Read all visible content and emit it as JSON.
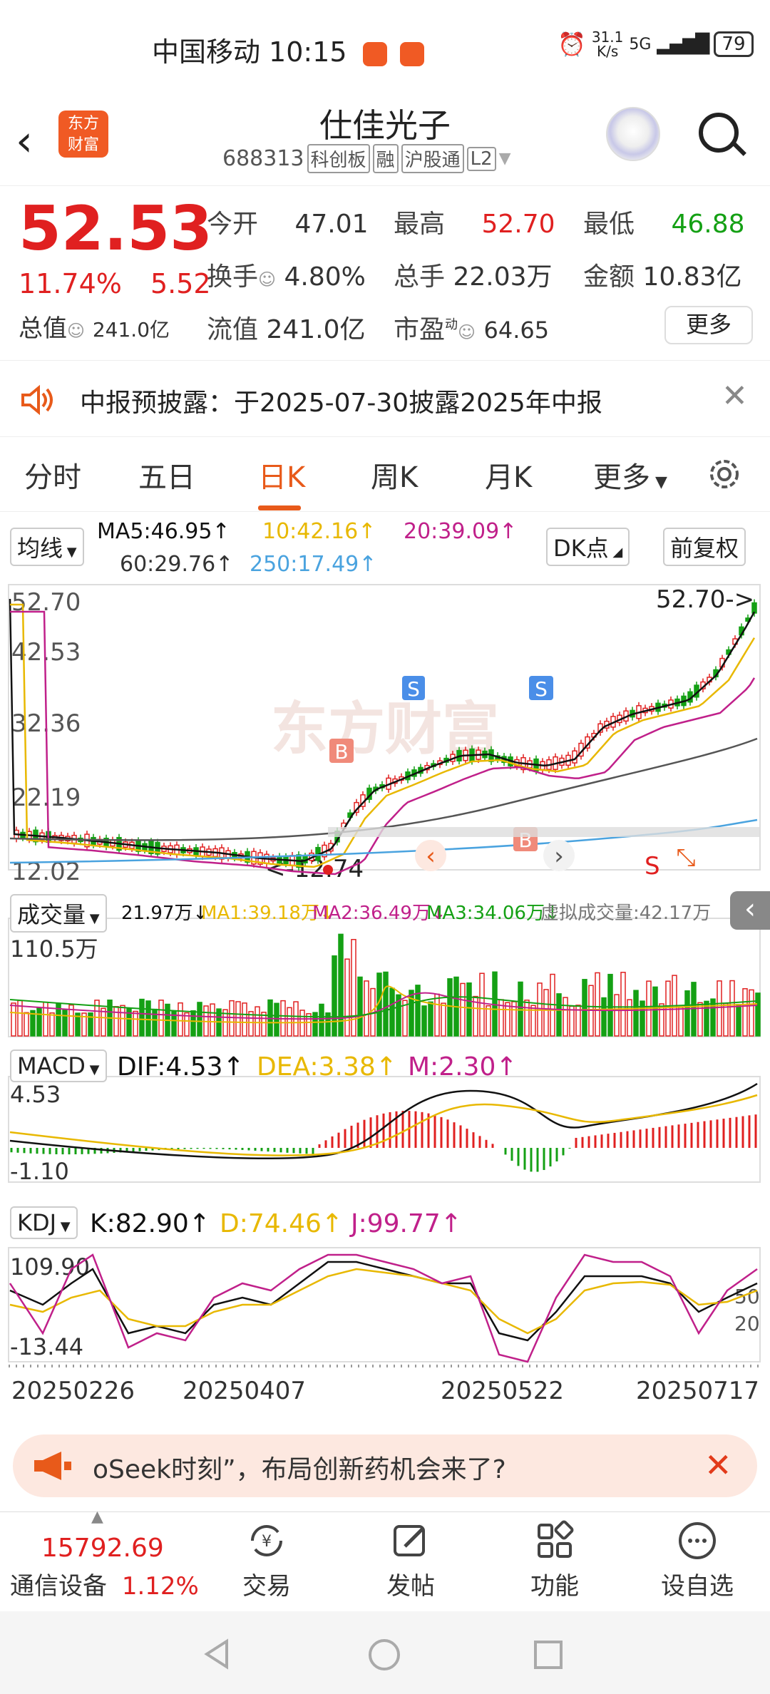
{
  "status_bar": {
    "carrier": "中国移动",
    "time": "10:15",
    "net_speed": "31.1\nK/s",
    "network": "5G",
    "battery": "79"
  },
  "header": {
    "logo_text": "东方\n财富",
    "stock_name": "仕佳光子",
    "stock_code": "688313",
    "tags": [
      "科创板",
      "融",
      "沪股通",
      "L2"
    ]
  },
  "quote": {
    "price": "52.53",
    "change_pct": "11.74%",
    "change_amt": "5.52",
    "mcap_label": "总值",
    "mcap_value": "241.0亿",
    "open_label": "今开",
    "open_value": "47.01",
    "high_label": "最高",
    "high_value": "52.70",
    "low_label": "最低",
    "low_value": "46.88",
    "turnover_label": "换手",
    "turnover_value": "4.80%",
    "volume_label": "总手",
    "volume_value": "22.03万",
    "amount_label": "金额",
    "amount_value": "10.83亿",
    "float_label": "流值",
    "float_value": "241.0亿",
    "pe_label": "市盈",
    "pe_sup": "动",
    "pe_value": "64.65",
    "more_label": "更多"
  },
  "notice": {
    "text": "中报预披露：于2025-07-30披露2025年中报"
  },
  "tabs": [
    "分时",
    "五日",
    "日K",
    "周K",
    "月K",
    "更多"
  ],
  "active_tab": "日K",
  "chart": {
    "ma_select": "均线",
    "ma5": "MA5:46.95↑",
    "ma10": "10:42.16↑",
    "ma20": "20:39.09↑",
    "ma60": "60:29.76↑",
    "ma250": "250:17.49↑",
    "dk_label": "DK点",
    "adjust_label": "前复权",
    "y_labels": [
      "52.70",
      "42.53",
      "32.36",
      "22.19",
      "12.02"
    ],
    "high_marker": "52.70->",
    "low_marker": "<-12.74",
    "watermark": "东方财富",
    "vol_select": "成交量",
    "vol_value": "21.97万↓",
    "vol_ma1": "MA1:39.18万↓",
    "vol_ma2": "MA2:36.49万↓",
    "vol_ma3": "MA3:34.06万↓",
    "vol_virtual": "虚拟成交量:42.17万",
    "vol_y_label": "110.5万",
    "macd_select": "MACD",
    "macd_dif": "DIF:4.53↑",
    "macd_dea": "DEA:3.38↑",
    "macd_m": "M:2.30↑",
    "macd_top": "4.53",
    "macd_bottom": "-1.10",
    "kdj_select": "KDJ",
    "kdj_k": "K:82.90↑",
    "kdj_d": "D:74.46↑",
    "kdj_j": "J:99.77↑",
    "kdj_top": "109.90",
    "kdj_bottom": "-13.44",
    "kdj_50": "50",
    "kdj_20": "20",
    "dates": [
      "20250226",
      "20250407",
      "20250522",
      "20250717"
    ],
    "colors": {
      "ma5": "#111111",
      "ma10": "#e8b800",
      "ma20": "#c0208a",
      "ma60": "#555555",
      "ma250": "#4aa3df",
      "up": "#e02020",
      "down": "#14a014"
    }
  },
  "promo": {
    "text": "oSeek时刻”，布局创新药机会来了?"
  },
  "bottom_bar": {
    "index_value": "15792.69",
    "index_name": "通信设备",
    "index_change": "1.12%",
    "nav": [
      "交易",
      "发帖",
      "功能",
      "设自选"
    ]
  },
  "chart_data": {
    "type": "candlestick",
    "x": [
      "20250226",
      "20250407",
      "20250522",
      "20250717"
    ],
    "ylim": [
      12.02,
      52.7
    ],
    "y_ticks": [
      52.7,
      42.53,
      32.36,
      22.19,
      12.02
    ],
    "high": 52.7,
    "low": 12.74,
    "series": [
      {
        "name": "MA5",
        "value": 46.95
      },
      {
        "name": "MA10",
        "value": 42.16
      },
      {
        "name": "MA20",
        "value": 39.09
      },
      {
        "name": "MA60",
        "value": 29.76
      },
      {
        "name": "MA250",
        "value": 17.49
      }
    ]
  }
}
